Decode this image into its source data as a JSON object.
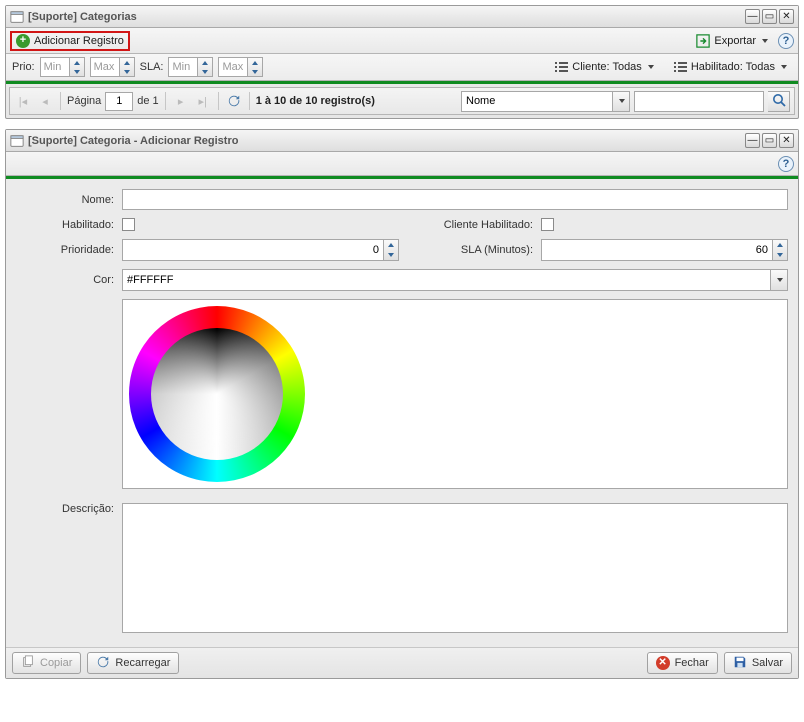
{
  "panel1": {
    "title": "[Suporte] Categorias",
    "add_label": "Adicionar Registro",
    "export_label": "Exportar",
    "prio_label": "Prio:",
    "sla_label": "SLA:",
    "min_ph": "Min",
    "max_ph": "Max",
    "filter_cliente": "Cliente: Todas",
    "filter_habilitado": "Habilitado: Todas",
    "paging": {
      "page_label": "Página",
      "page_value": "1",
      "of_label": "de 1",
      "summary": "1 à 10 de 10 registro(s)",
      "search_field": "Nome"
    }
  },
  "panel2": {
    "title": "[Suporte] Categoria - Adicionar Registro",
    "labels": {
      "nome": "Nome:",
      "habilitado": "Habilitado:",
      "cliente_hab": "Cliente Habilitado:",
      "prioridade": "Prioridade:",
      "sla": "SLA (Minutos):",
      "cor": "Cor:",
      "descricao": "Descrição:"
    },
    "values": {
      "prioridade": "0",
      "sla": "60",
      "cor": "#FFFFFF"
    },
    "buttons": {
      "copiar": "Copiar",
      "recarregar": "Recarregar",
      "fechar": "Fechar",
      "salvar": "Salvar"
    }
  }
}
